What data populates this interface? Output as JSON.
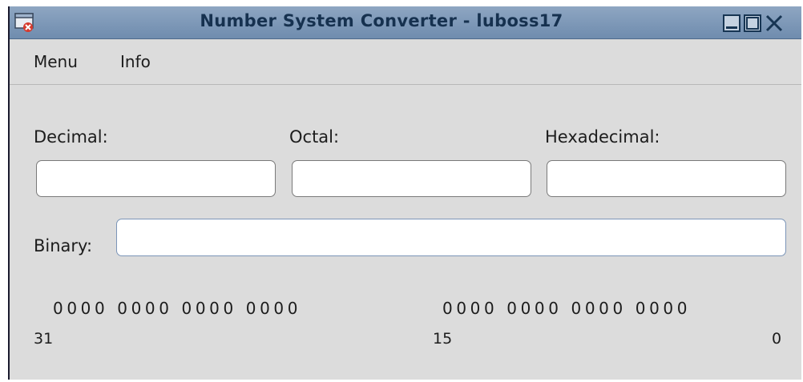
{
  "window": {
    "title": "Number System Converter - luboss17",
    "icon": "application-icon"
  },
  "menubar": {
    "items": [
      {
        "label": "Menu"
      },
      {
        "label": "Info"
      }
    ]
  },
  "fields": {
    "decimal": {
      "label": "Decimal:",
      "value": ""
    },
    "octal": {
      "label": "Octal:",
      "value": ""
    },
    "hexadecimal": {
      "label": "Hexadecimal:",
      "value": ""
    },
    "binary": {
      "label": "Binary:",
      "value": ""
    }
  },
  "bit_display": {
    "high_word": "0000 0000 0000 0000",
    "low_word": "0000 0000 0000 0000",
    "index_31": "31",
    "index_15": "15",
    "index_0": "0"
  },
  "colors": {
    "titlebar": "#7f99b9",
    "window_bg": "#dcdcdc",
    "binary_focus_border": "#7b95b8"
  }
}
